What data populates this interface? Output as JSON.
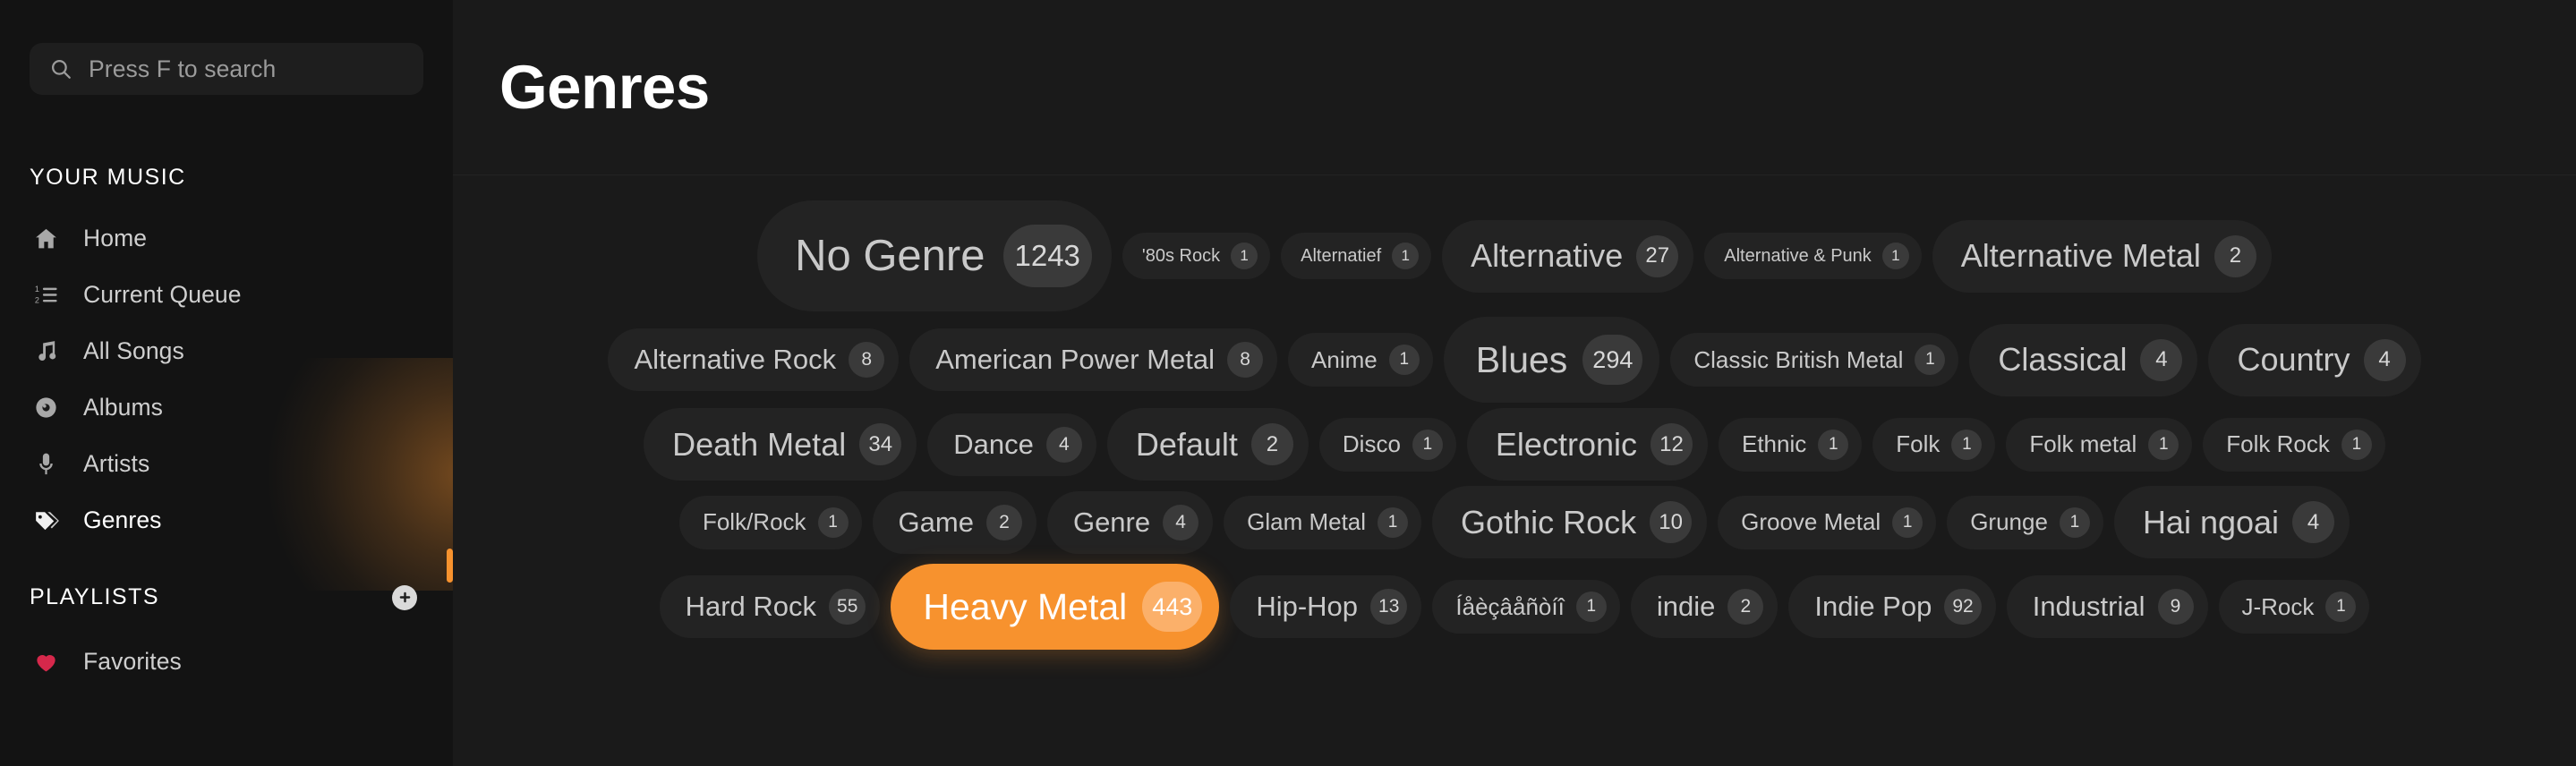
{
  "sidebar": {
    "search": {
      "icon": "search-icon",
      "placeholder": "Press F to search",
      "value": ""
    },
    "your_music_label": "YOUR MUSIC",
    "nav_items": [
      {
        "label": "Home",
        "icon": "home-icon",
        "active": false
      },
      {
        "label": "Current Queue",
        "icon": "queue-list-icon",
        "active": false
      },
      {
        "label": "All Songs",
        "icon": "music-note-icon",
        "active": false
      },
      {
        "label": "Albums",
        "icon": "disc-icon",
        "active": false
      },
      {
        "label": "Artists",
        "icon": "microphone-icon",
        "active": false
      },
      {
        "label": "Genres",
        "icon": "tag-icon",
        "active": true
      }
    ],
    "playlists_label": "PLAYLISTS",
    "add_playlist_icon": "plus-icon",
    "playlists": [
      {
        "label": "Favorites",
        "icon": "heart-icon",
        "color": "#d6284b"
      }
    ],
    "scroll_indicator_color": "#f7922e"
  },
  "main": {
    "title": "Genres",
    "accent_color": "#f7922e",
    "selected_genre": "Heavy Metal",
    "genre_rows": [
      [
        {
          "label": "No Genre",
          "count": "1243",
          "size": "xxl",
          "selected": false
        },
        {
          "label": "'80s Rock",
          "count": "1",
          "size": "xs",
          "selected": false
        },
        {
          "label": "Alternatief",
          "count": "1",
          "size": "xs",
          "selected": false
        },
        {
          "label": "Alternative",
          "count": "27",
          "size": "l",
          "selected": false
        },
        {
          "label": "Alternative & Punk",
          "count": "1",
          "size": "xs",
          "selected": false
        },
        {
          "label": "Alternative Metal",
          "count": "2",
          "size": "l",
          "selected": false
        }
      ],
      [
        {
          "label": "Alternative Rock",
          "count": "8",
          "size": "m",
          "selected": false
        },
        {
          "label": "American Power Metal",
          "count": "8",
          "size": "m",
          "selected": false
        },
        {
          "label": "Anime",
          "count": "1",
          "size": "s",
          "selected": false
        },
        {
          "label": "Blues",
          "count": "294",
          "size": "xl",
          "selected": false
        },
        {
          "label": "Classic British Metal",
          "count": "1",
          "size": "s",
          "selected": false
        },
        {
          "label": "Classical",
          "count": "4",
          "size": "l",
          "selected": false
        },
        {
          "label": "Country",
          "count": "4",
          "size": "l",
          "selected": false
        }
      ],
      [
        {
          "label": "Death Metal",
          "count": "34",
          "size": "l",
          "selected": false
        },
        {
          "label": "Dance",
          "count": "4",
          "size": "m",
          "selected": false
        },
        {
          "label": "Default",
          "count": "2",
          "size": "l",
          "selected": false
        },
        {
          "label": "Disco",
          "count": "1",
          "size": "s",
          "selected": false
        },
        {
          "label": "Electronic",
          "count": "12",
          "size": "l",
          "selected": false
        },
        {
          "label": "Ethnic",
          "count": "1",
          "size": "s",
          "selected": false
        },
        {
          "label": "Folk",
          "count": "1",
          "size": "s",
          "selected": false
        },
        {
          "label": "Folk metal",
          "count": "1",
          "size": "s",
          "selected": false
        },
        {
          "label": "Folk Rock",
          "count": "1",
          "size": "s",
          "selected": false
        }
      ],
      [
        {
          "label": "Folk/Rock",
          "count": "1",
          "size": "s",
          "selected": false
        },
        {
          "label": "Game",
          "count": "2",
          "size": "m",
          "selected": false
        },
        {
          "label": "Genre",
          "count": "4",
          "size": "m",
          "selected": false
        },
        {
          "label": "Glam Metal",
          "count": "1",
          "size": "s",
          "selected": false
        },
        {
          "label": "Gothic Rock",
          "count": "10",
          "size": "l",
          "selected": false
        },
        {
          "label": "Groove Metal",
          "count": "1",
          "size": "s",
          "selected": false
        },
        {
          "label": "Grunge",
          "count": "1",
          "size": "s",
          "selected": false
        },
        {
          "label": "Hai ngoai",
          "count": "4",
          "size": "l",
          "selected": false
        }
      ],
      [
        {
          "label": "Hard Rock",
          "count": "55",
          "size": "m",
          "selected": false
        },
        {
          "label": "Heavy Metal",
          "count": "443",
          "size": "xl",
          "selected": true
        },
        {
          "label": "Hip-Hop",
          "count": "13",
          "size": "m",
          "selected": false
        },
        {
          "label": "Íåèçâåñòíî",
          "count": "1",
          "size": "s",
          "selected": false
        },
        {
          "label": "indie",
          "count": "2",
          "size": "m",
          "selected": false
        },
        {
          "label": "Indie Pop",
          "count": "92",
          "size": "m",
          "selected": false
        },
        {
          "label": "Industrial",
          "count": "9",
          "size": "m",
          "selected": false
        },
        {
          "label": "J-Rock",
          "count": "1",
          "size": "s",
          "selected": false
        }
      ]
    ]
  }
}
